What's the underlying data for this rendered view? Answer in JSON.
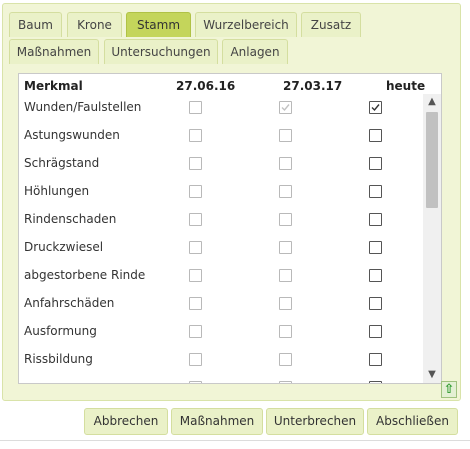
{
  "tabs": [
    {
      "label": "Baum",
      "active": false
    },
    {
      "label": "Krone",
      "active": false
    },
    {
      "label": "Stamm",
      "active": true
    },
    {
      "label": "Wurzelbereich",
      "active": false
    },
    {
      "label": "Zusatz",
      "active": false
    },
    {
      "label": "Maßnahmen",
      "active": false
    },
    {
      "label": "Untersuchungen",
      "active": false
    },
    {
      "label": "Anlagen",
      "active": false
    }
  ],
  "table": {
    "headers": [
      "Merkmal",
      "27.06.16",
      "27.03.17",
      "heute"
    ],
    "rows": [
      {
        "label": "Wunden/Faulstellen",
        "values": [
          false,
          true,
          true
        ]
      },
      {
        "label": "Astungswunden",
        "values": [
          false,
          false,
          false
        ]
      },
      {
        "label": "Schrägstand",
        "values": [
          false,
          false,
          false
        ]
      },
      {
        "label": "Höhlungen",
        "values": [
          false,
          false,
          false
        ]
      },
      {
        "label": "Rindenschaden",
        "values": [
          false,
          false,
          false
        ]
      },
      {
        "label": "Druckzwiesel",
        "values": [
          false,
          false,
          false
        ]
      },
      {
        "label": "abgestorbene Rinde",
        "values": [
          false,
          false,
          false
        ]
      },
      {
        "label": "Anfahrschäden",
        "values": [
          false,
          false,
          false
        ]
      },
      {
        "label": "Ausformung",
        "values": [
          false,
          false,
          false
        ]
      },
      {
        "label": "Rissbildung",
        "values": [
          false,
          false,
          false
        ]
      }
    ]
  },
  "buttons": {
    "cancel": "Abbrechen",
    "measures": "Maßnahmen",
    "interrupt": "Unterbrechen",
    "finish": "Abschließen"
  },
  "icons": {
    "scroll_up": "chevron-up-icon",
    "scroll_down": "chevron-down-icon",
    "back_to_top": "arrow-up-icon"
  },
  "colors": {
    "panel_bg": "#f1f5d6",
    "tab_bg": "#eaf1c8",
    "tab_active": "#c4d55b",
    "arrow_green": "#2e9a2e"
  }
}
